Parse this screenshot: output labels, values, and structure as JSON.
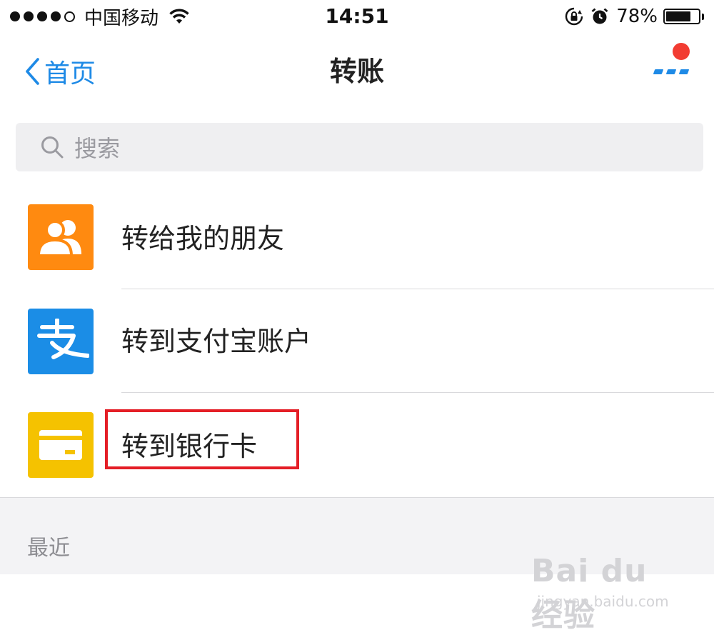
{
  "status_bar": {
    "carrier": "中国移动",
    "time": "14:51",
    "battery_percent": "78%",
    "battery_level": 0.78
  },
  "nav": {
    "back_label": "首页",
    "title": "转账",
    "more_badge_color": "#f23c32",
    "accent_color": "#1e8ae6"
  },
  "search": {
    "placeholder": "搜索"
  },
  "list": [
    {
      "label": "转给我的朋友",
      "icon": "friends-icon",
      "color": "#ff8a10"
    },
    {
      "label": "转到支付宝账户",
      "icon": "alipay-icon",
      "color": "#1b8de6"
    },
    {
      "label": "转到银行卡",
      "icon": "bank-card-icon",
      "color": "#f5c200"
    }
  ],
  "recent": {
    "label": "最近"
  },
  "watermark": {
    "brand": "Bai du 经验",
    "url": "jingyan.baidu.com"
  }
}
